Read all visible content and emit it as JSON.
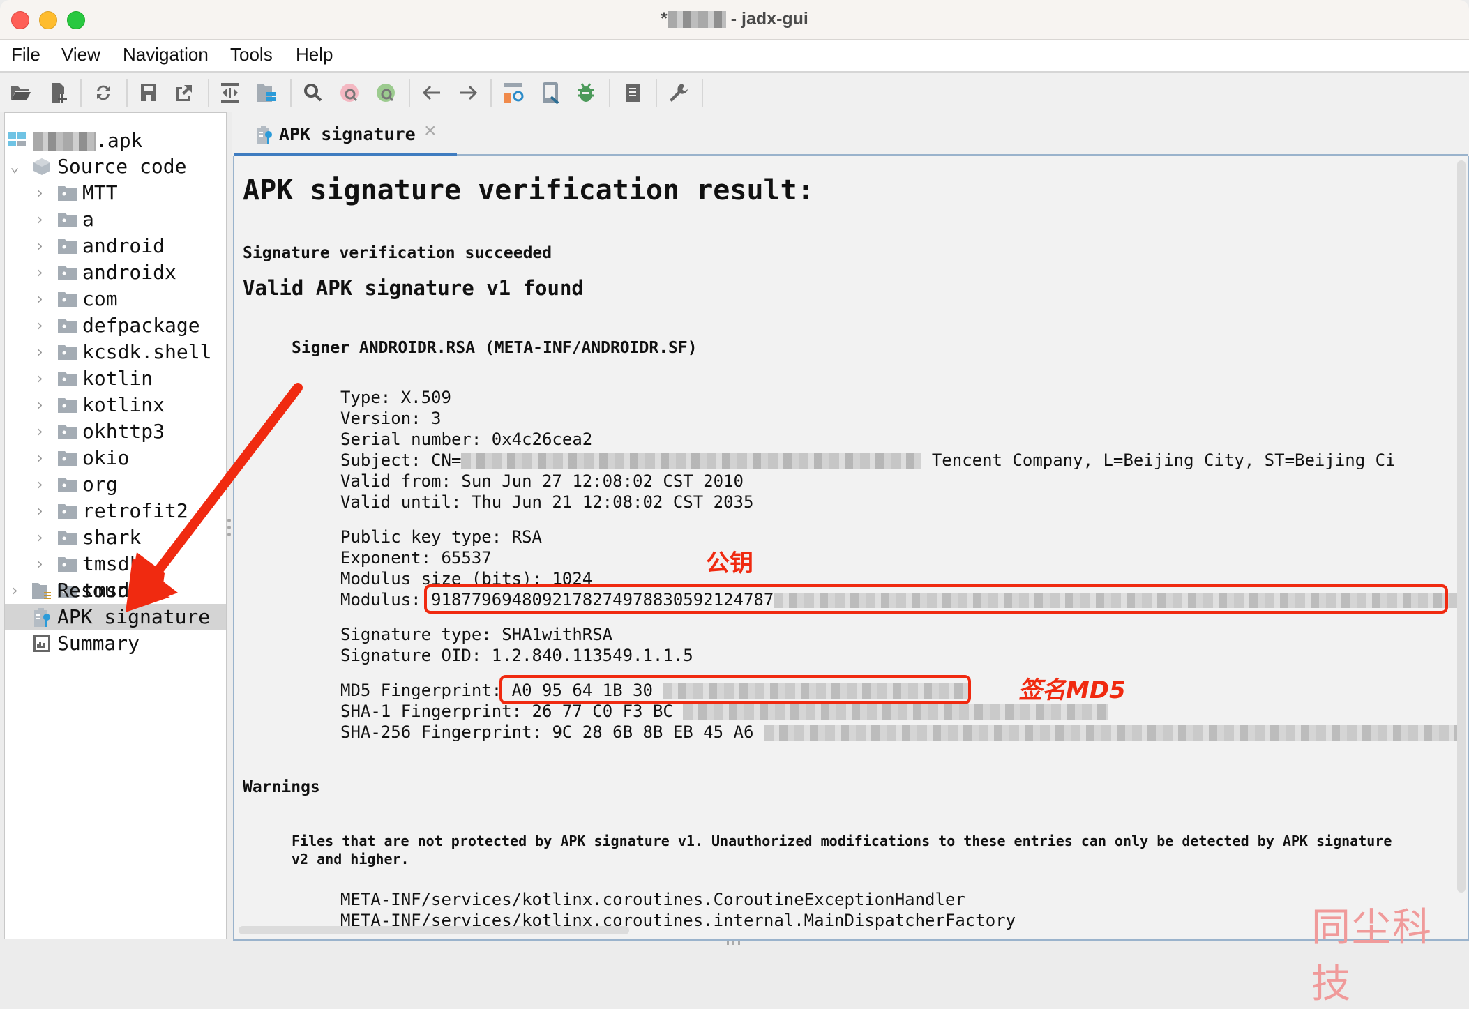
{
  "window": {
    "title_prefix": "*",
    "title_suffix": " - jadx-gui"
  },
  "menu": [
    "File",
    "View",
    "Navigation",
    "Tools",
    "Help"
  ],
  "toolbar": {
    "icons": [
      "open-file-icon",
      "add-files-icon",
      "reload-icon",
      "save-all-icon",
      "export-icon",
      "sync-with-editor-icon",
      "flatten-packages-icon",
      "search-text-icon",
      "search-class-icon",
      "search-usage-icon",
      "back-icon",
      "forward-icon",
      "deobfuscation-icon",
      "log-viewer-icon",
      "debugger-icon",
      "quark-icon",
      "preferences-icon"
    ]
  },
  "tree": {
    "root_suffix": ".apk",
    "source_code": "Source code",
    "packages": [
      "MTT",
      "a",
      "android",
      "androidx",
      "com",
      "defpackage",
      "kcsdk.shell",
      "kotlin",
      "kotlinx",
      "okhttp3",
      "okio",
      "org",
      "retrofit2",
      "shark",
      "tmsdk",
      "tmsdk f"
    ],
    "resources": "Resources",
    "apk_signature": "APK signature",
    "summary": "Summary"
  },
  "tab": {
    "label": "APK signature",
    "close": "×"
  },
  "content": {
    "heading": "APK signature verification result:",
    "status": "Signature verification succeeded",
    "v1_found": "Valid APK signature v1 found",
    "signer": "Signer ANDROIDR.RSA (META-INF/ANDROIDR.SF)",
    "type": "Type: X.509",
    "version": "Version: 3",
    "serial": "Serial number: 0x4c26cea2",
    "subject_prefix": "Subject: CN=",
    "subject_suffix": "Tencent Company, L=Beijing City, ST=Beijing Ci",
    "valid_from": "Valid from: Sun Jun 27 12:08:02 CST 2010",
    "valid_until": "Valid until: Thu Jun 21 12:08:02 CST 2035",
    "pubkey_type": "Public key type: RSA",
    "exponent": "Exponent: 65537",
    "modulus_size": "Modulus size (bits): 1024",
    "modulus_label": "Modulus: ",
    "modulus_value": "9187796948092178274978830592124787",
    "sig_type": "Signature type: SHA1withRSA",
    "sig_oid": "Signature OID: 1.2.840.113549.1.1.5",
    "md5_label": "MD5 Fingerprint: ",
    "md5_value": "A0 95 64 1B 30",
    "sha1_label": "SHA-1 Fingerprint: ",
    "sha1_value": "26 77 C0 F3 BC",
    "sha256_label": "SHA-256 Fingerprint: ",
    "sha256_value": "9C 28 6B 8B EB 45 A6",
    "warnings_heading": "Warnings",
    "warning_text_1": "Files that are not protected by APK signature v1. Unauthorized modifications to these entries can only be detected by APK signature",
    "warning_text_2": "v2 and higher.",
    "files": [
      "META-INF/services/kotlinx.coroutines.CoroutineExceptionHandler",
      "META-INF/services/kotlinx.coroutines.internal.MainDispatcherFactory"
    ]
  },
  "annotations": {
    "public_key": "公钥",
    "signature_md5": "签名MD5",
    "color": "#f02a10"
  },
  "watermark": "同尘科技",
  "colors": {
    "accent": "#3f7cc0",
    "selection": "#d4d4d4"
  }
}
